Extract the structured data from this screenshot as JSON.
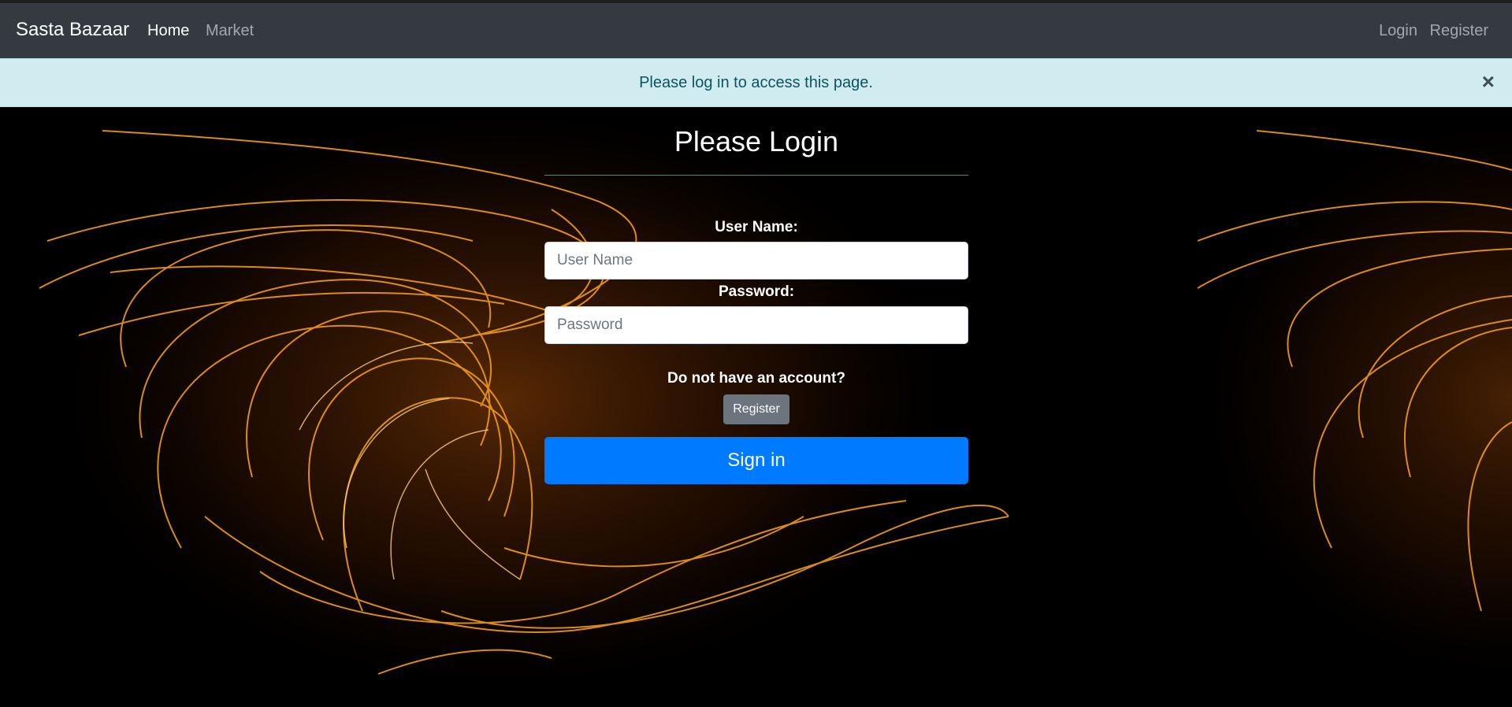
{
  "navbar": {
    "brand": "Sasta Bazaar",
    "left_links": [
      "Home",
      "Market"
    ],
    "right_links": [
      "Login",
      "Register"
    ]
  },
  "alert": {
    "message": "Please log in to access this page.",
    "close": "×"
  },
  "form": {
    "title": "Please Login",
    "username_label": "User Name:",
    "username_placeholder": "User Name",
    "username_value": "",
    "password_label": "Password:",
    "password_placeholder": "Password",
    "password_value": "",
    "no_account_text": "Do not have an account?",
    "register_button": "Register",
    "signin_button": "Sign in"
  },
  "colors": {
    "navbar_bg": "#343a40",
    "alert_bg": "#d1ecf1",
    "alert_text": "#0c5460",
    "primary": "#007bff",
    "secondary": "#6c757d",
    "swirl": "#f7a21b"
  }
}
